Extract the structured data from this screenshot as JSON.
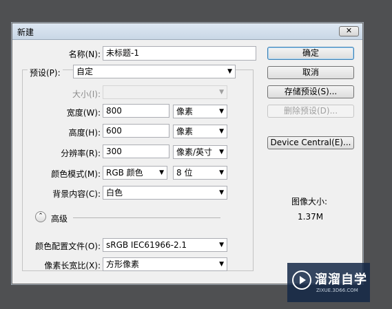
{
  "window": {
    "title": "新建",
    "close_icon": "close-icon"
  },
  "form": {
    "name_label": "名称(N):",
    "name_value": "未标题-1",
    "preset_label": "预设(P):",
    "preset_value": "自定",
    "size_label": "大小(I):",
    "size_value": "",
    "width_label": "宽度(W):",
    "width_value": "800",
    "width_unit": "像素",
    "height_label": "高度(H):",
    "height_value": "600",
    "height_unit": "像素",
    "resolution_label": "分辨率(R):",
    "resolution_value": "300",
    "resolution_unit": "像素/英寸",
    "color_mode_label": "颜色模式(M):",
    "color_mode_value": "RGB 颜色",
    "bit_depth_value": "8 位",
    "background_label": "背景内容(C):",
    "background_value": "白色",
    "advanced_label": "高级",
    "color_profile_label": "颜色配置文件(O):",
    "color_profile_value": "sRGB IEC61966-2.1",
    "pixel_aspect_label": "像素长宽比(X):",
    "pixel_aspect_value": "方形像素"
  },
  "buttons": {
    "ok": "确定",
    "cancel": "取消",
    "save_preset": "存储预设(S)...",
    "delete_preset": "删除预设(D)...",
    "device_central": "Device Central(E)..."
  },
  "info": {
    "image_size_label": "图像大小:",
    "image_size_value": "1.37M"
  },
  "watermark": {
    "brand": "溜溜自学",
    "url": "ZIXUE.3D66.COM"
  }
}
